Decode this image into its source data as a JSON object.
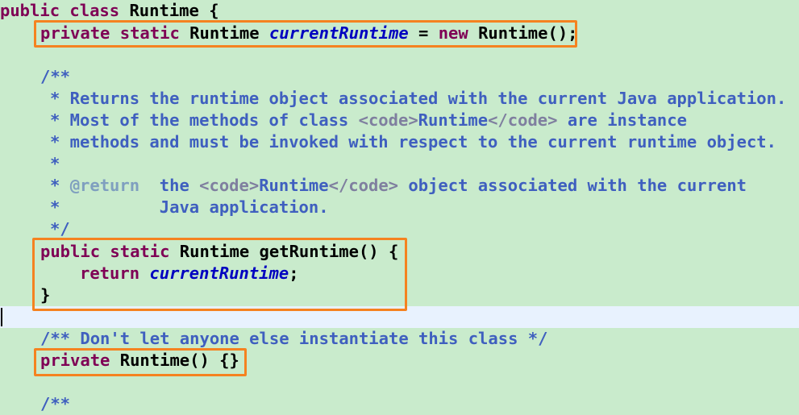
{
  "code": {
    "l1": {
      "kw": "public class ",
      "name": "Runtime",
      "rest": " {"
    },
    "l2": {
      "kw1": "private static ",
      "type": "Runtime ",
      "field": "currentRuntime",
      "op": " = ",
      "kw2": "new ",
      "ctor": "Runtime();"
    },
    "l4": {
      "doc": "/**"
    },
    "l5": {
      "doc": "* Returns the runtime object associated with the current Java application."
    },
    "l6": {
      "doc_a": "* Most of the methods of class ",
      "tag_open": "<code>",
      "doc_b": "Runtime",
      "tag_close": "</code>",
      "doc_c": " are instance"
    },
    "l7": {
      "doc": "* methods and must be invoked with respect to the current runtime object."
    },
    "l8": {
      "doc": "*"
    },
    "l9": {
      "star": "* ",
      "kwdoc": "@return",
      "doc_a": "  the ",
      "tag_open": "<code>",
      "doc_b": "Runtime",
      "tag_close": "</code>",
      "doc_c": " object associated with the current"
    },
    "l10": {
      "doc": "*          Java application."
    },
    "l11": {
      "doc": "*/"
    },
    "l12": {
      "kw": "public static ",
      "type": "Runtime ",
      "name": "getRuntime() {"
    },
    "l13": {
      "kw": "return ",
      "field": "currentRuntime",
      "rest": ";"
    },
    "l14": {
      "text": "}"
    },
    "l16": {
      "doc": "/** Don't let anyone else instantiate this class */"
    },
    "l17": {
      "kw": "private ",
      "name": "Runtime() {}"
    },
    "l19": {
      "doc": "/**"
    }
  },
  "colors": {
    "background": "#c9ebcc",
    "keyword": "#7f0055",
    "field": "#0000c0",
    "javadoc": "#3f5fbf",
    "highlight_box": "#f58220",
    "current_line": "#e8f2fe"
  }
}
